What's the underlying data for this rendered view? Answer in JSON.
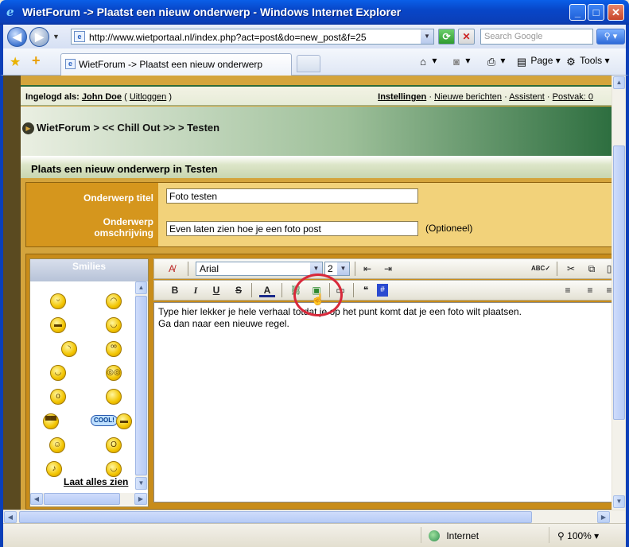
{
  "window": {
    "title": "WietForum -> Plaatst een nieuw onderwerp - Windows Internet Explorer",
    "min_label": "_",
    "max_label": "□",
    "close_label": "✕"
  },
  "addressbar": {
    "url": "http://www.wietportaal.nl/index.php?act=post&do=new_post&f=25",
    "search_placeholder": "Search Google"
  },
  "tabbar": {
    "tab_label": "WietForum -> Plaatst een nieuw onderwerp",
    "page_menu": "Page",
    "tools_menu": "Tools"
  },
  "forum": {
    "login_prefix": "Ingelogd als:",
    "username": "John Doe",
    "logout": "Uitloggen",
    "links": [
      "Instellingen",
      "Nieuwe berichten",
      "Assistent",
      "Postvak: 0"
    ],
    "breadcrumb": "WietForum > << Chill Out >> > Testen",
    "form_title": "Plaats een nieuw onderwerp in Testen",
    "subject_label": "Onderwerp titel",
    "subject_value": "Foto testen",
    "desc_label_1": "Onderwerp",
    "desc_label_2": "omschrijving",
    "desc_value": "Even laten zien hoe je een foto post",
    "optional": "(Optioneel)"
  },
  "smilies": {
    "title": "Smilies",
    "show_all": "Laat alles zien",
    "cool_badge": "COOL!"
  },
  "editor": {
    "font": "Arial",
    "size": "2",
    "text_line_1": "Type hier lekker je hele verhaal totdat je op het punt komt dat je een foto wilt plaatsen.",
    "text_line_2": "Ga dan naar een nieuwe regel."
  },
  "statusbar": {
    "zone": "Internet",
    "zoom": "100%"
  }
}
